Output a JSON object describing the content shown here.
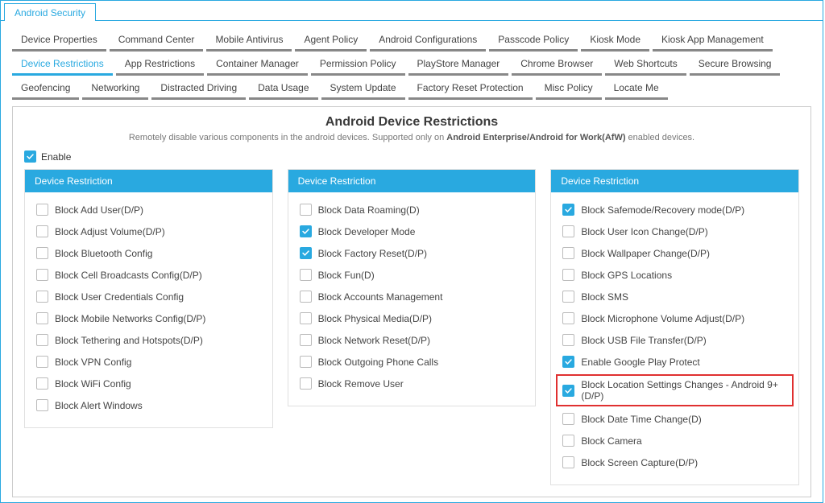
{
  "topTab": "Android Security",
  "navTabs": [
    {
      "label": "Device Properties",
      "active": false
    },
    {
      "label": "Command Center",
      "active": false
    },
    {
      "label": "Mobile Antivirus",
      "active": false
    },
    {
      "label": "Agent Policy",
      "active": false
    },
    {
      "label": "Android Configurations",
      "active": false
    },
    {
      "label": "Passcode Policy",
      "active": false
    },
    {
      "label": "Kiosk Mode",
      "active": false
    },
    {
      "label": "Kiosk App Management",
      "active": false
    },
    {
      "label": "Device Restrictions",
      "active": true
    },
    {
      "label": "App Restrictions",
      "active": false
    },
    {
      "label": "Container Manager",
      "active": false
    },
    {
      "label": "Permission Policy",
      "active": false
    },
    {
      "label": "PlayStore Manager",
      "active": false
    },
    {
      "label": "Chrome Browser",
      "active": false
    },
    {
      "label": "Web Shortcuts",
      "active": false
    },
    {
      "label": "Secure Browsing",
      "active": false
    },
    {
      "label": "Geofencing",
      "active": false
    },
    {
      "label": "Networking",
      "active": false
    },
    {
      "label": "Distracted Driving",
      "active": false
    },
    {
      "label": "Data Usage",
      "active": false
    },
    {
      "label": "System Update",
      "active": false
    },
    {
      "label": "Factory Reset Protection",
      "active": false
    },
    {
      "label": "Misc Policy",
      "active": false
    },
    {
      "label": "Locate Me",
      "active": false
    }
  ],
  "panelTitle": "Android Device Restrictions",
  "panelSubPrefix": "Remotely disable various components in the android devices. Supported only on ",
  "panelSubBold": "Android Enterprise/Android for Work(AfW)",
  "panelSubSuffix": " enabled devices.",
  "enableLabel": "Enable",
  "enableChecked": true,
  "columnHeader": "Device Restriction",
  "col1": [
    {
      "label": "Block Add User(D/P)",
      "checked": false
    },
    {
      "label": "Block Adjust Volume(D/P)",
      "checked": false
    },
    {
      "label": "Block Bluetooth Config",
      "checked": false
    },
    {
      "label": "Block Cell Broadcasts Config(D/P)",
      "checked": false
    },
    {
      "label": "Block User Credentials Config",
      "checked": false
    },
    {
      "label": "Block Mobile Networks Config(D/P)",
      "checked": false
    },
    {
      "label": "Block Tethering and Hotspots(D/P)",
      "checked": false
    },
    {
      "label": "Block VPN Config",
      "checked": false
    },
    {
      "label": "Block WiFi Config",
      "checked": false
    },
    {
      "label": "Block Alert Windows",
      "checked": false
    }
  ],
  "col2": [
    {
      "label": "Block Data Roaming(D)",
      "checked": false
    },
    {
      "label": "Block Developer Mode",
      "checked": true
    },
    {
      "label": "Block Factory Reset(D/P)",
      "checked": true
    },
    {
      "label": "Block Fun(D)",
      "checked": false
    },
    {
      "label": "Block Accounts Management",
      "checked": false
    },
    {
      "label": "Block Physical Media(D/P)",
      "checked": false
    },
    {
      "label": "Block Network Reset(D/P)",
      "checked": false
    },
    {
      "label": "Block Outgoing Phone Calls",
      "checked": false
    },
    {
      "label": "Block Remove User",
      "checked": false
    }
  ],
  "col3": [
    {
      "label": "Block Safemode/Recovery mode(D/P)",
      "checked": true,
      "highlight": false
    },
    {
      "label": "Block User Icon Change(D/P)",
      "checked": false,
      "highlight": false
    },
    {
      "label": "Block Wallpaper Change(D/P)",
      "checked": false,
      "highlight": false
    },
    {
      "label": "Block GPS Locations",
      "checked": false,
      "highlight": false
    },
    {
      "label": "Block SMS",
      "checked": false,
      "highlight": false
    },
    {
      "label": "Block Microphone Volume Adjust(D/P)",
      "checked": false,
      "highlight": false
    },
    {
      "label": "Block USB File Transfer(D/P)",
      "checked": false,
      "highlight": false
    },
    {
      "label": "Enable Google Play Protect",
      "checked": true,
      "highlight": false
    },
    {
      "label": "Block Location Settings Changes - Android 9+ (D/P)",
      "checked": true,
      "highlight": true
    },
    {
      "label": "Block Date Time Change(D)",
      "checked": false,
      "highlight": false
    },
    {
      "label": "Block Camera",
      "checked": false,
      "highlight": false
    },
    {
      "label": "Block Screen Capture(D/P)",
      "checked": false,
      "highlight": false
    }
  ]
}
